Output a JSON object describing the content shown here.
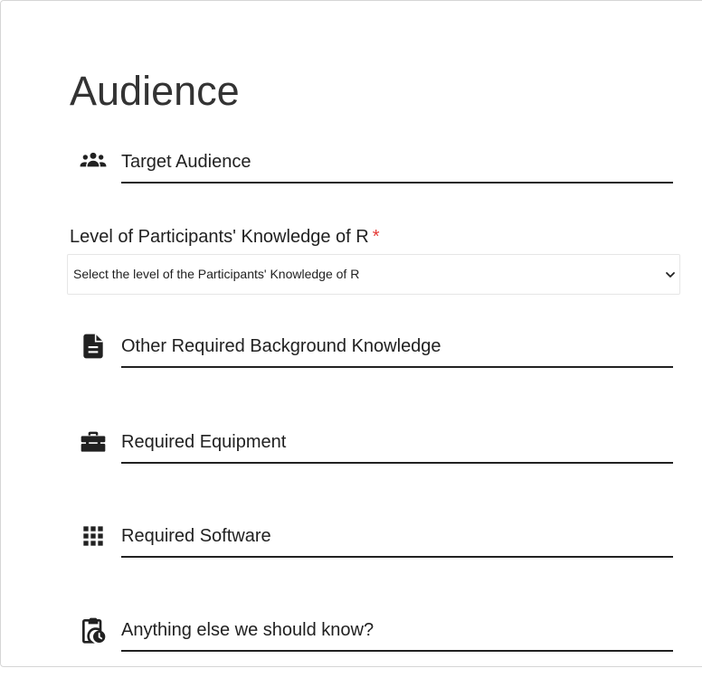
{
  "section": {
    "title": "Audience"
  },
  "fields": {
    "target_audience": {
      "placeholder": "Target Audience",
      "icon": "people-group-icon"
    },
    "background_knowledge": {
      "placeholder": "Other Required Background Knowledge",
      "icon": "document-icon"
    },
    "equipment": {
      "placeholder": "Required Equipment",
      "icon": "toolbox-icon"
    },
    "software": {
      "placeholder": "Required Software",
      "icon": "apps-grid-icon"
    },
    "anything_else": {
      "placeholder": "Anything else we should know?",
      "icon": "clipboard-clock-icon"
    }
  },
  "knowledge_level": {
    "label": "Level of Participants' Knowledge of R",
    "required_marker": "*",
    "selected": "Select the level of the Participants' Knowledge of R"
  },
  "colors": {
    "text": "#212121",
    "required": "#e53935",
    "border": "#d6d6d6"
  }
}
